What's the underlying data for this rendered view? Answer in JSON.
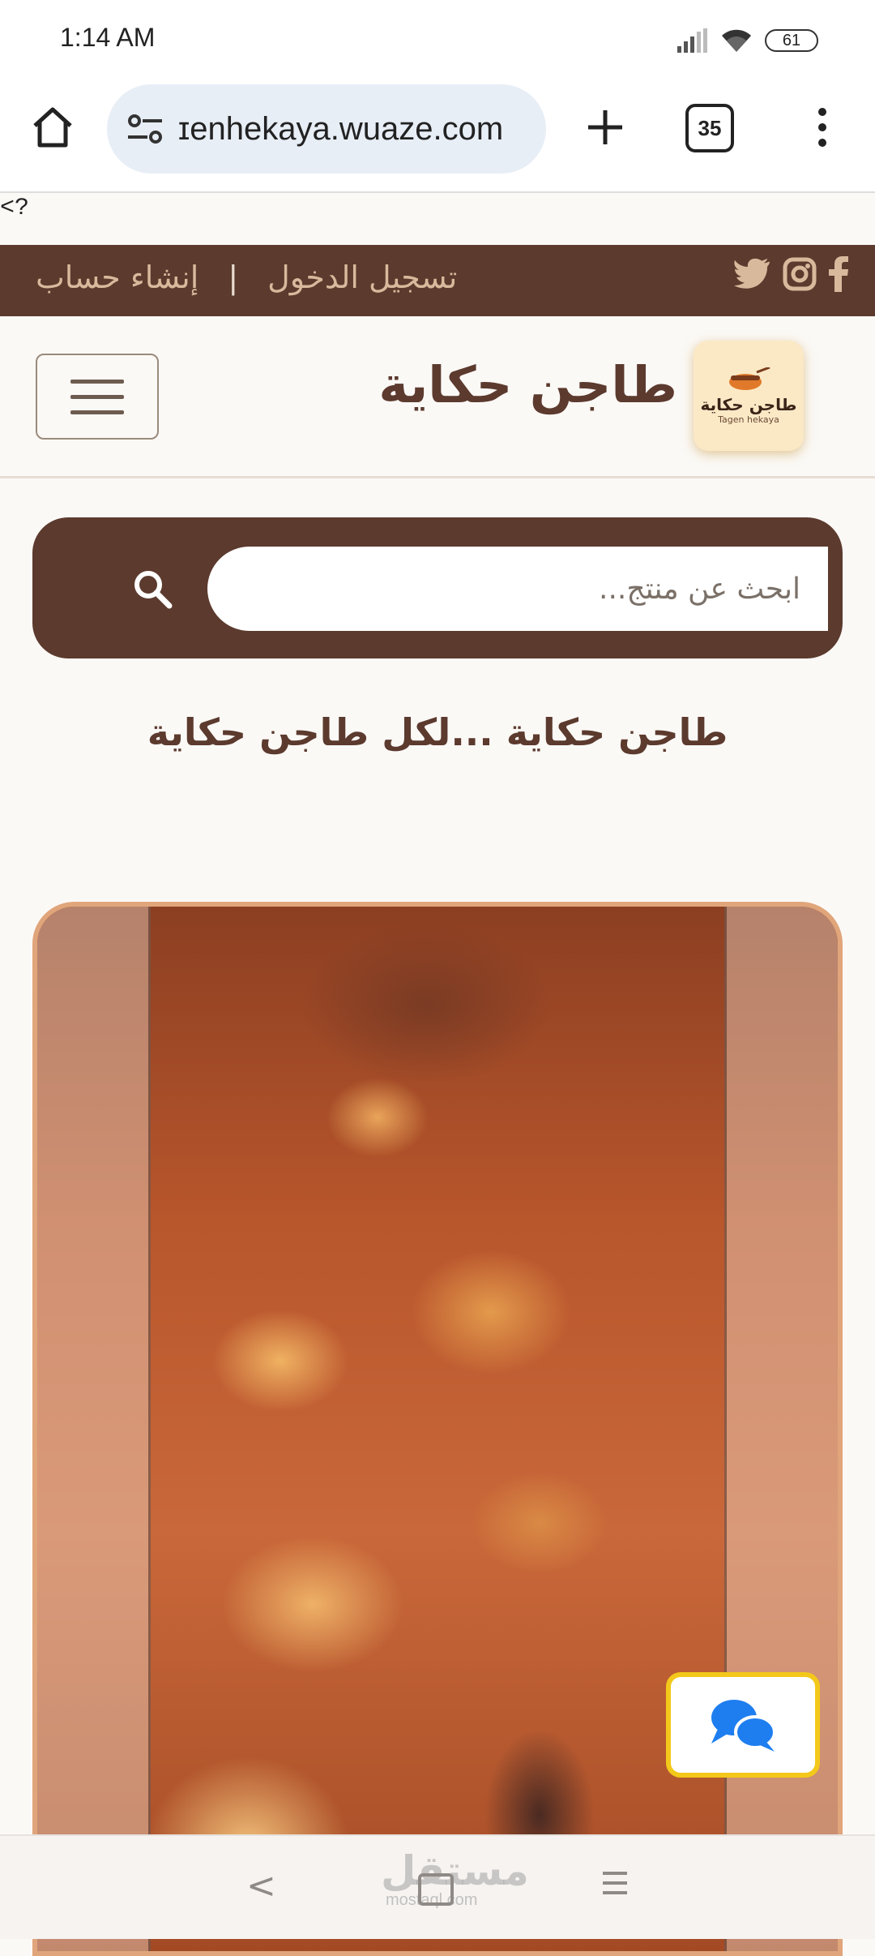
{
  "status_bar": {
    "time": "1:14 AM",
    "battery": "61"
  },
  "browser": {
    "url": "ɪenhekaya.wuaze.com",
    "tab_count": "35"
  },
  "stray_text": "<?",
  "topbar": {
    "login": "تسجيل الدخول",
    "separator": "|",
    "signup": "إنشاء حساب",
    "social_icons": [
      "facebook-icon",
      "instagram-icon",
      "twitter-icon"
    ]
  },
  "header": {
    "site_title": "طاجن حكاية",
    "logo_text": "طاجن حكاية",
    "logo_sub": "Tagen hekaya"
  },
  "search": {
    "placeholder": "ابحث عن منتج..."
  },
  "tagline": "طاجن حكاية ...لكل طاجن حكاية",
  "navbar": {
    "back": "<",
    "watermark": "مستقل",
    "watermark_sub": "mostaql.com"
  },
  "colors": {
    "brand_brown": "#5c3a2e",
    "accent_tan": "#d9b99c",
    "chat_border": "#f3c81a",
    "chat_icon": "#1e7ef0"
  }
}
